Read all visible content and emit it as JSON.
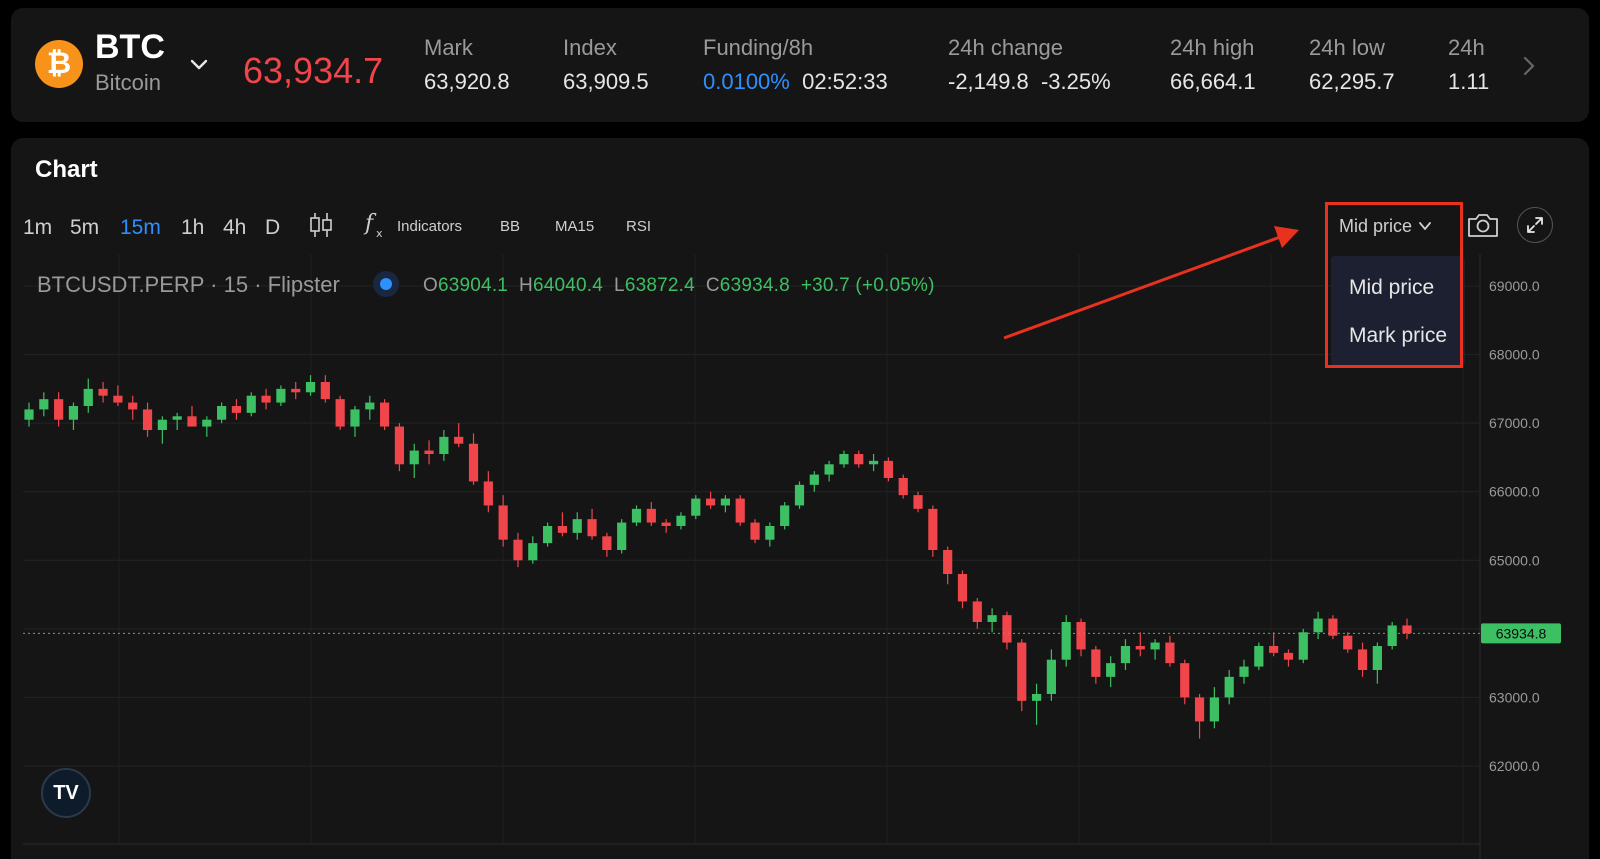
{
  "header": {
    "symbol": "BTC",
    "name": "Bitcoin",
    "last_price": "63,934.7",
    "stats": [
      {
        "label": "Mark",
        "value": "63,920.8"
      },
      {
        "label": "Index",
        "value": "63,909.5"
      },
      {
        "label": "Funding/8h",
        "rate": "0.0100%",
        "countdown": "02:52:33"
      },
      {
        "label": "24h change",
        "change": "-2,149.8",
        "change_pct": "-3.25%"
      },
      {
        "label": "24h high",
        "value": "66,664.1"
      },
      {
        "label": "24h low",
        "value": "62,295.7"
      },
      {
        "label": "24h",
        "value": "1.11"
      }
    ]
  },
  "chart_panel": {
    "title": "Chart",
    "timeframes": [
      "1m",
      "5m",
      "15m",
      "1h",
      "4h",
      "D"
    ],
    "active_timeframe": "15m",
    "tools": {
      "indicators": "Indicators",
      "bb": "BB",
      "ma15": "MA15",
      "rsi": "RSI"
    },
    "price_source": {
      "selected": "Mid price",
      "options": [
        "Mid price",
        "Mark price"
      ]
    },
    "legend": {
      "symbol_line": "BTCUSDT.PERP · 15 · Flipster",
      "o_label": "O",
      "o": "63904.1",
      "h_label": "H",
      "h": "64040.4",
      "l_label": "L",
      "l": "63872.4",
      "c_label": "C",
      "c": "63934.8",
      "change": "+30.7 (+0.05%)"
    },
    "logo_text": "TV"
  },
  "colors": {
    "up": "#3dbf63",
    "down": "#f0454b",
    "accent": "#2e8fff",
    "annotation": "#e8311f",
    "coin": "#f7931a"
  },
  "icons": [
    "chevron-down-icon",
    "chevron-right-icon",
    "candlestick-icon",
    "fx-icon",
    "camera-icon",
    "expand-icon"
  ],
  "chart_data": {
    "type": "candlestick",
    "y_ticks": [
      "69000.0",
      "68000.0",
      "67000.0",
      "66000.0",
      "65000.0",
      "63000.0",
      "62000.0"
    ],
    "ylim": [
      61000,
      69500
    ],
    "last_price_label": "63934.8",
    "last_price": 63934.8,
    "grid": true,
    "series": [
      {
        "name": "BTCUSDT.PERP",
        "values": [
          [
            67050,
            67300,
            66950,
            67200
          ],
          [
            67200,
            67450,
            67100,
            67350
          ],
          [
            67350,
            67450,
            66950,
            67050
          ],
          [
            67050,
            67300,
            66900,
            67250
          ],
          [
            67250,
            67650,
            67150,
            67500
          ],
          [
            67500,
            67600,
            67300,
            67400
          ],
          [
            67400,
            67550,
            67250,
            67300
          ],
          [
            67300,
            67400,
            67050,
            67200
          ],
          [
            67200,
            67300,
            66800,
            66900
          ],
          [
            66900,
            67100,
            66700,
            67050
          ],
          [
            67050,
            67150,
            66900,
            67100
          ],
          [
            67100,
            67250,
            66950,
            66950
          ],
          [
            66950,
            67100,
            66800,
            67050
          ],
          [
            67050,
            67300,
            67000,
            67250
          ],
          [
            67250,
            67350,
            67050,
            67150
          ],
          [
            67150,
            67450,
            67100,
            67400
          ],
          [
            67400,
            67500,
            67200,
            67300
          ],
          [
            67300,
            67550,
            67250,
            67500
          ],
          [
            67500,
            67600,
            67350,
            67450
          ],
          [
            67450,
            67700,
            67400,
            67600
          ],
          [
            67600,
            67700,
            67300,
            67350
          ],
          [
            67350,
            67400,
            66900,
            66950
          ],
          [
            66950,
            67250,
            66800,
            67200
          ],
          [
            67200,
            67400,
            67050,
            67300
          ],
          [
            67300,
            67350,
            66900,
            66950
          ],
          [
            66950,
            67000,
            66300,
            66400
          ],
          [
            66400,
            66700,
            66200,
            66600
          ],
          [
            66600,
            66750,
            66400,
            66550
          ],
          [
            66550,
            66900,
            66450,
            66800
          ],
          [
            66800,
            67000,
            66650,
            66700
          ],
          [
            66700,
            66850,
            66100,
            66150
          ],
          [
            66150,
            66300,
            65700,
            65800
          ],
          [
            65800,
            65950,
            65200,
            65300
          ],
          [
            65300,
            65400,
            64900,
            65000
          ],
          [
            65000,
            65350,
            64950,
            65250
          ],
          [
            65250,
            65550,
            65200,
            65500
          ],
          [
            65500,
            65700,
            65350,
            65400
          ],
          [
            65400,
            65700,
            65300,
            65600
          ],
          [
            65600,
            65750,
            65300,
            65350
          ],
          [
            65350,
            65400,
            65050,
            65150
          ],
          [
            65150,
            65600,
            65100,
            65550
          ],
          [
            65550,
            65800,
            65500,
            65750
          ],
          [
            65750,
            65850,
            65500,
            65550
          ],
          [
            65550,
            65600,
            65400,
            65500
          ],
          [
            65500,
            65700,
            65450,
            65650
          ],
          [
            65650,
            65950,
            65600,
            65900
          ],
          [
            65900,
            66000,
            65750,
            65800
          ],
          [
            65800,
            65950,
            65700,
            65900
          ],
          [
            65900,
            65950,
            65500,
            65550
          ],
          [
            65550,
            65600,
            65250,
            65300
          ],
          [
            65300,
            65550,
            65200,
            65500
          ],
          [
            65500,
            65850,
            65450,
            65800
          ],
          [
            65800,
            66150,
            65750,
            66100
          ],
          [
            66100,
            66300,
            66000,
            66250
          ],
          [
            66250,
            66450,
            66150,
            66400
          ],
          [
            66400,
            66600,
            66350,
            66550
          ],
          [
            66550,
            66600,
            66350,
            66400
          ],
          [
            66400,
            66550,
            66300,
            66450
          ],
          [
            66450,
            66500,
            66150,
            66200
          ],
          [
            66200,
            66250,
            65900,
            65950
          ],
          [
            65950,
            66000,
            65700,
            65750
          ],
          [
            65750,
            65800,
            65050,
            65150
          ],
          [
            65150,
            65200,
            64650,
            64800
          ],
          [
            64800,
            64850,
            64300,
            64400
          ],
          [
            64400,
            64450,
            64000,
            64100
          ],
          [
            64100,
            64300,
            63950,
            64200
          ],
          [
            64200,
            64250,
            63700,
            63800
          ],
          [
            63800,
            63850,
            62800,
            62950
          ],
          [
            62950,
            63200,
            62600,
            63050
          ],
          [
            63050,
            63700,
            62950,
            63550
          ],
          [
            63550,
            64200,
            63450,
            64100
          ],
          [
            64100,
            64150,
            63600,
            63700
          ],
          [
            63700,
            63750,
            63200,
            63300
          ],
          [
            63300,
            63600,
            63150,
            63500
          ],
          [
            63500,
            63850,
            63400,
            63750
          ],
          [
            63750,
            63950,
            63600,
            63700
          ],
          [
            63700,
            63850,
            63550,
            63800
          ],
          [
            63800,
            63900,
            63450,
            63500
          ],
          [
            63500,
            63550,
            62900,
            63000
          ],
          [
            63000,
            63050,
            62400,
            62650
          ],
          [
            62650,
            63150,
            62550,
            63000
          ],
          [
            63000,
            63400,
            62900,
            63300
          ],
          [
            63300,
            63550,
            63200,
            63450
          ],
          [
            63450,
            63800,
            63400,
            63750
          ],
          [
            63750,
            63950,
            63600,
            63650
          ],
          [
            63650,
            63700,
            63450,
            63550
          ],
          [
            63550,
            64000,
            63500,
            63950
          ],
          [
            63950,
            64250,
            63850,
            64150
          ],
          [
            64150,
            64200,
            63850,
            63900
          ],
          [
            63900,
            63950,
            63650,
            63700
          ],
          [
            63700,
            63800,
            63300,
            63400
          ],
          [
            63400,
            63800,
            63200,
            63750
          ],
          [
            63750,
            64100,
            63700,
            64050
          ],
          [
            64050,
            64150,
            63850,
            63934.8
          ]
        ]
      }
    ]
  }
}
